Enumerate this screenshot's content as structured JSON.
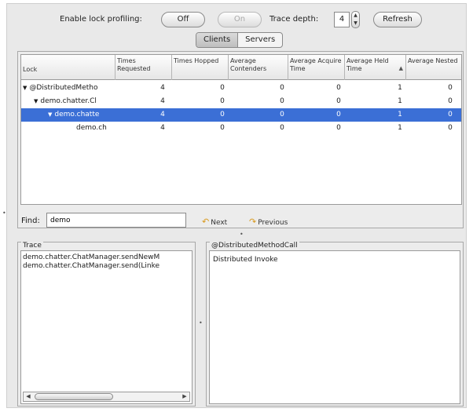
{
  "toolbar": {
    "lock_profiling_label": "Enable lock profiling:",
    "off_label": "Off",
    "on_label": "On",
    "trace_depth_label": "Trace depth:",
    "trace_depth_value": "4",
    "refresh_label": "Refresh"
  },
  "tabs": [
    {
      "label": "Clients",
      "selected": true
    },
    {
      "label": "Servers",
      "selected": false
    }
  ],
  "table": {
    "headers": {
      "lock": "Lock",
      "times_requested": "Times Requested",
      "times_hopped": "Times Hopped",
      "avg_contenders": "Average Contenders",
      "avg_acquire": "Average Acquire Time",
      "avg_held": "Average Held Time",
      "avg_nested": "Average Nested"
    },
    "rows": [
      {
        "lock": "@DistributedMetho",
        "req": "4",
        "hop": "0",
        "cont": "0",
        "acq": "0",
        "held": "1",
        "nest": "0"
      },
      {
        "lock": "demo.chatter.Cl",
        "req": "4",
        "hop": "0",
        "cont": "0",
        "acq": "0",
        "held": "1",
        "nest": "0"
      },
      {
        "lock": "demo.chatte",
        "req": "4",
        "hop": "0",
        "cont": "0",
        "acq": "0",
        "held": "1",
        "nest": "0"
      },
      {
        "lock": "demo.ch",
        "req": "4",
        "hop": "0",
        "cont": "0",
        "acq": "0",
        "held": "1",
        "nest": "0"
      }
    ],
    "selected_row_color": "#3b6fd6"
  },
  "find": {
    "label": "Find:",
    "value": "demo",
    "next_label": "Next",
    "previous_label": "Previous"
  },
  "trace": {
    "title": "Trace",
    "lines": [
      "demo.chatter.ChatManager.sendNewM",
      "demo.chatter.ChatManager.send(Linke"
    ]
  },
  "detail": {
    "title": "@DistributedMethodCall",
    "text": "Distributed Invoke"
  }
}
